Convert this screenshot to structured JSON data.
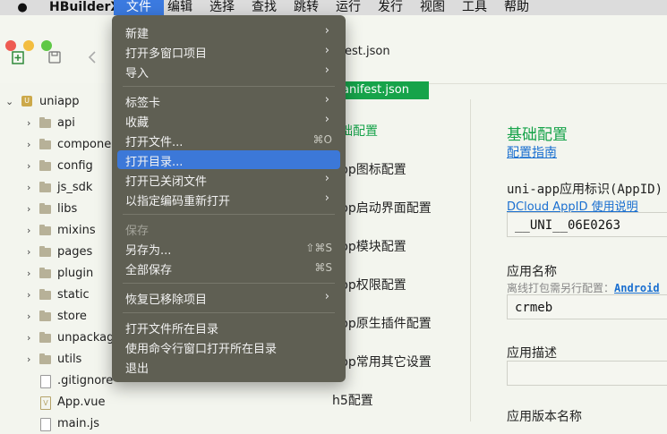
{
  "menubar": {
    "apple": "",
    "items": [
      "HBuilderX",
      "文件",
      "编辑",
      "选择",
      "查找",
      "跳转",
      "运行",
      "发行",
      "视图",
      "工具",
      "帮助"
    ]
  },
  "editor": {
    "file_tab": "est.json",
    "green_tab": "anifest.json"
  },
  "tree": {
    "project": "uniapp",
    "folders": [
      "api",
      "components",
      "config",
      "js_sdk",
      "libs",
      "mixins",
      "pages",
      "plugin",
      "static",
      "store",
      "unpackage",
      "utils"
    ],
    "files": [
      ".gitignore",
      "App.vue",
      "main.js"
    ]
  },
  "nav": {
    "items": [
      "础配置",
      "pp图标配置",
      "pp启动界面配置",
      "pp模块配置",
      "pp权限配置",
      "pp原生插件配置",
      "pp常用其它设置",
      "h5配置"
    ]
  },
  "content": {
    "heading": "基础配置",
    "guide_link": "配置指南",
    "appid_label": "uni-app应用标识(AppID)",
    "appid_link": "DCloud AppID 使用说明",
    "appid_value": "__UNI__06E0263",
    "name_label": "应用名称",
    "name_hint": "离线打包需另行配置：",
    "name_hint_link": "Android",
    "name_value": "crmeb",
    "desc_label": "应用描述",
    "version_label": "应用版本名称"
  },
  "file_menu": {
    "items": [
      {
        "label": "新建",
        "arrow": "›"
      },
      {
        "label": "打开多窗口项目",
        "arrow": "›"
      },
      {
        "label": "导入",
        "arrow": "›"
      },
      {
        "label": "标签卡",
        "arrow": "›"
      },
      {
        "label": "收藏",
        "arrow": "›"
      },
      {
        "label": "打开文件...",
        "shortcut": "⌘O"
      },
      {
        "label": "打开目录..."
      },
      {
        "label": "打开已关闭文件",
        "arrow": "›"
      },
      {
        "label": "以指定编码重新打开",
        "arrow": "›"
      },
      {
        "label": "保存"
      },
      {
        "label": "另存为...",
        "shortcut": "⇧⌘S"
      },
      {
        "label": "全部保存",
        "shortcut": "⌘S"
      },
      {
        "label": "恢复已移除项目",
        "arrow": "›"
      },
      {
        "label": "打开文件所在目录"
      },
      {
        "label": "使用命令行窗口打开所在目录"
      },
      {
        "label": "退出"
      }
    ]
  }
}
